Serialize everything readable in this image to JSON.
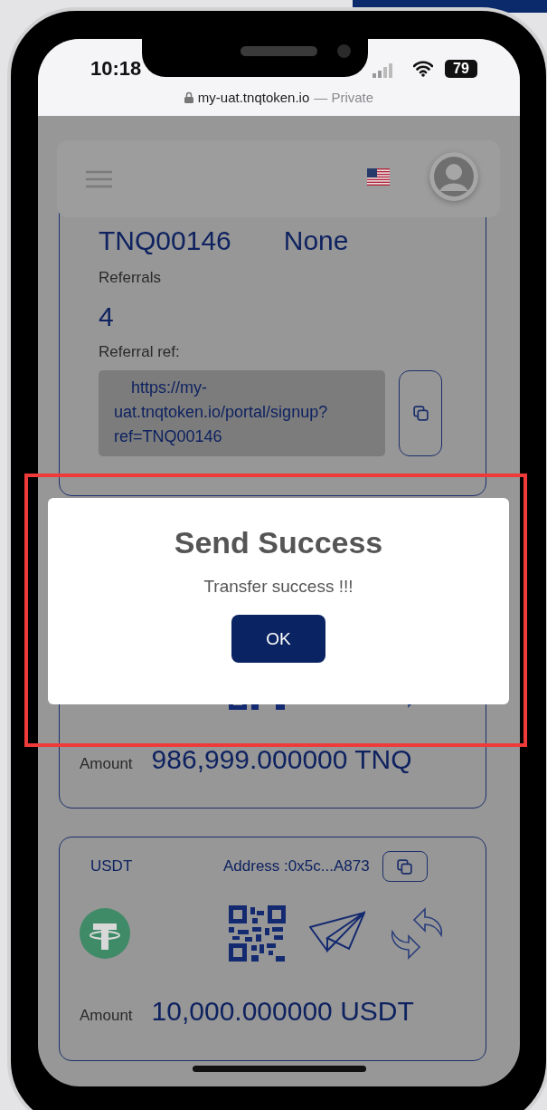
{
  "status_bar": {
    "time": "10:18",
    "battery": "79"
  },
  "address_bar": {
    "domain": "my-uat.tnqtoken.io",
    "mode": "— Private"
  },
  "referral_card": {
    "code": "TNQ00146",
    "rank": "None",
    "referrals_label": "Referrals",
    "referrals_count": "4",
    "ref_label": "Referral ref:",
    "ref_link": "https://my-uat.tnqtoken.io/portal/signup?ref=TNQ00146"
  },
  "wallets": [
    {
      "amount_label": "Amount",
      "amount": "986,999.000000 TNQ"
    },
    {
      "symbol": "USDT",
      "address": "Address :0x5c...A873",
      "amount_label": "Amount",
      "amount": "10,000.000000 USDT"
    }
  ],
  "dialog": {
    "title": "Send Success",
    "message": "Transfer success !!!",
    "button": "OK"
  }
}
